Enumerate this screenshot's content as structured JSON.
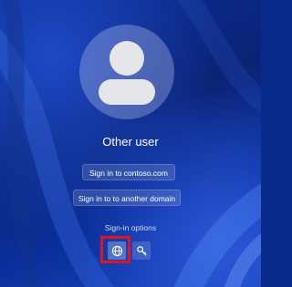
{
  "user": {
    "name": "Other user"
  },
  "buttons": {
    "sign_in_domain": "Sign in to contoso.com",
    "sign_in_other": "Sign in to to another domain"
  },
  "sign_in_options": {
    "label": "Sign-in options",
    "options": [
      {
        "icon": "globe-icon",
        "selected": true
      },
      {
        "icon": "key-icon",
        "selected": false
      }
    ]
  },
  "colors": {
    "background": "#0a2a8c",
    "highlight": "#e0151e",
    "text": "#ffffff"
  }
}
